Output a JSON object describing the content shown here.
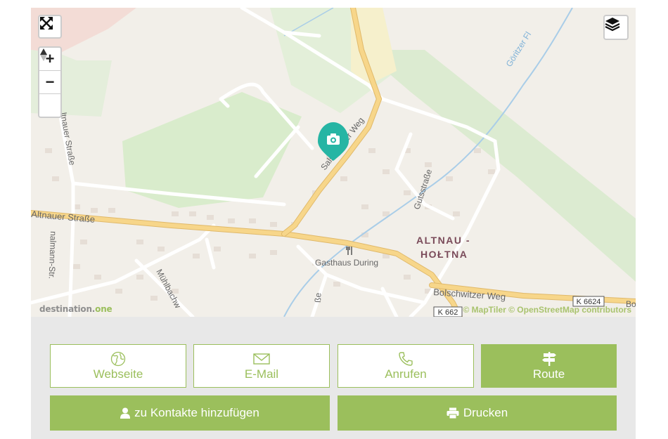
{
  "map": {
    "brand": {
      "text": "destination.",
      "accent": "one"
    },
    "attribution": "© MapTiler © OpenStreetMap contributors",
    "controls": {
      "zoom_in": "+",
      "zoom_out": "−"
    },
    "labels": {
      "altnauer_strasse_west": "Altnauer Straße",
      "altnauer_strasse_vertical": "ltnauer Straße",
      "salsiebener_weg": "Salsiebener Weg",
      "gutsstrasse": "Gutsstraße",
      "place_line1": "ALTNAU -",
      "place_line2": "HOŁTNA",
      "poi": "Gasthaus During",
      "bolschwitzer_weg": "Bolschwitzer Weg",
      "road_ref_1": "K 6624",
      "road_ref_2": "K 662",
      "goeritzer": "Göritzer Fl",
      "muehlbach": "Mühlbachw",
      "mann_str": "nalmann-Str.",
      "strasse_stub": "ße",
      "edge_bo": "Bo"
    },
    "marker_icon": "camera-icon"
  },
  "actions": {
    "website": "Webseite",
    "email": "E-Mail",
    "call": "Anrufen",
    "route": "Route",
    "add_contact": "zu Kontakte hinzufügen",
    "print": "Drucken"
  },
  "colors": {
    "accent": "#9bbf5c",
    "marker": "#26b5a4",
    "road_major": "#f7d68a",
    "map_bg": "#f2efe9",
    "panel_bg": "#e8e8e8"
  }
}
